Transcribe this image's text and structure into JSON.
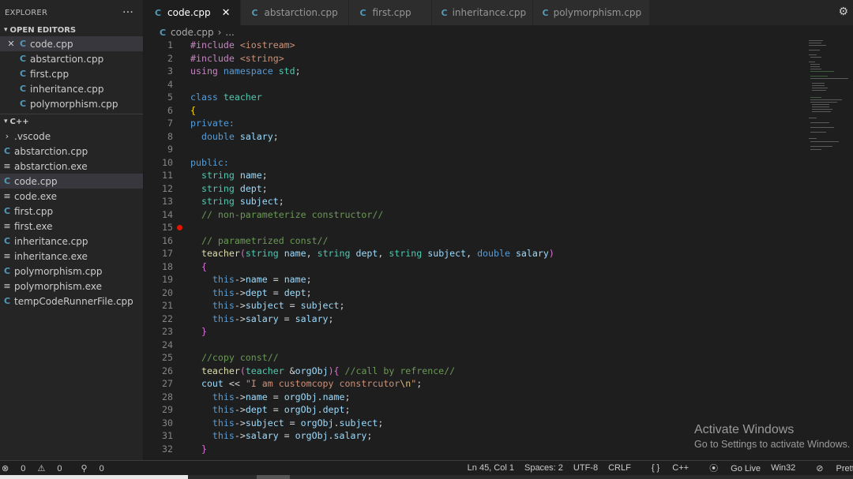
{
  "sidebar": {
    "title": "EXPLORER",
    "more": "···",
    "open_editors": {
      "title": "OPEN EDITORS",
      "items": [
        "code.cpp",
        "abstarction.cpp",
        "first.cpp",
        "inheritance.cpp",
        "polymorphism.cpp"
      ]
    },
    "folder": {
      "title": "C++",
      "items": [
        {
          "name": ".vscode",
          "kind": "folder"
        },
        {
          "name": "abstarction.cpp",
          "kind": "cpp"
        },
        {
          "name": "abstarction.exe",
          "kind": "exe"
        },
        {
          "name": "code.cpp",
          "kind": "cpp"
        },
        {
          "name": "code.exe",
          "kind": "exe"
        },
        {
          "name": "first.cpp",
          "kind": "cpp"
        },
        {
          "name": "first.exe",
          "kind": "exe"
        },
        {
          "name": "inheritance.cpp",
          "kind": "cpp"
        },
        {
          "name": "inheritance.exe",
          "kind": "exe"
        },
        {
          "name": "polymorphism.cpp",
          "kind": "cpp"
        },
        {
          "name": "polymorphism.exe",
          "kind": "exe"
        },
        {
          "name": "tempCodeRunnerFile.cpp",
          "kind": "cpp"
        }
      ]
    }
  },
  "tabs": [
    "code.cpp",
    "abstarction.cpp",
    "first.cpp",
    "inheritance.cpp",
    "polymorphism.cpp"
  ],
  "breadcrumb": {
    "file": "code.cpp",
    "rest": "..."
  },
  "editor": {
    "line_numbers": [
      "1",
      "2",
      "3",
      "4",
      "5",
      "6",
      "7",
      "8",
      "9",
      "10",
      "11",
      "12",
      "13",
      "14",
      "15",
      "16",
      "17",
      "18",
      "19",
      "20",
      "21",
      "22",
      "23",
      "24",
      "25",
      "26",
      "27",
      "28",
      "29",
      "30",
      "31",
      "32"
    ],
    "breakpoint_line": "15"
  },
  "watermark": {
    "line1": "Activate Windows",
    "line2": "Go to Settings to activate Windows."
  },
  "status": {
    "errors": "0",
    "warnings": "0",
    "broadcast": "0",
    "position": "Ln 45, Col 1",
    "spaces": "Spaces: 2",
    "encoding": "UTF-8",
    "eol": "CRLF",
    "language": "C++",
    "golive": "Go Live",
    "platform": "Win32",
    "prettier": "Prettier"
  },
  "colors": {
    "accent": "#007acc",
    "breakpoint": "#e51400",
    "keyword": "#569cd6",
    "type": "#4ec9b0",
    "variable": "#9cdcfe",
    "comment": "#6a9955",
    "string": "#ce9178"
  }
}
